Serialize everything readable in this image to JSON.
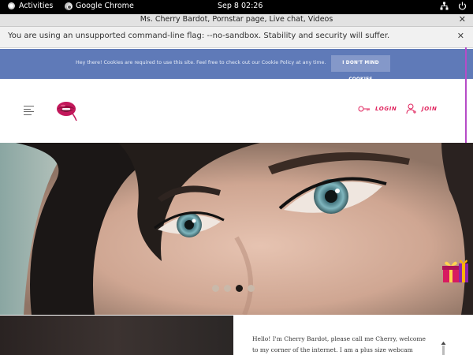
{
  "topbar": {
    "activities": "Activities",
    "app_name": "Google Chrome",
    "clock": "Sep 8  02:26"
  },
  "window": {
    "title": "Ms. Cherry Bardot, Pornstar page, Live chat, Videos"
  },
  "infobar": {
    "message": "You are using an unsupported command-line flag: --no-sandbox. Stability and security will suffer."
  },
  "cookie_banner": {
    "text": "Hey there! Cookies are required to use this site. Feel free to check out our Cookie Policy at any time.",
    "button_label": "I DON'T MIND COOKIES"
  },
  "nav": {
    "login_label": "LOGIN",
    "join_label": "JOIN",
    "accent_color": "#e0245e"
  },
  "hero": {
    "slide_count": 4,
    "active_slide": 3
  },
  "bio": {
    "text": "Hello! I'm Cherry Bardot, please call me Cherry, welcome to my corner of the internet. I am a plus size webcam performer and"
  }
}
